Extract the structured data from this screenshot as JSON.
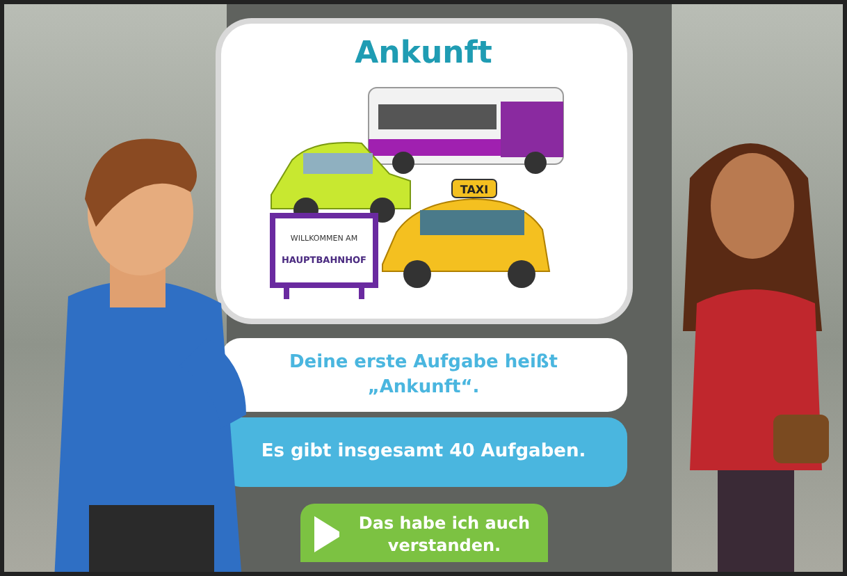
{
  "lesson_card": {
    "title": "Ankunft",
    "illustration": {
      "sign_lines": [
        "WILLKOMMEN AM",
        "HAUPTBAHNHOF"
      ],
      "taxi_sign": "TAXI"
    }
  },
  "bubbles": [
    {
      "kind": "narrator",
      "text": "Deine erste Aufgabe heißt „Ankunft“."
    },
    {
      "kind": "speaker",
      "text": "Es gibt insgesamt 40 Aufgaben."
    }
  ],
  "continue_button": {
    "label": "Das habe ich auch verstanden."
  }
}
